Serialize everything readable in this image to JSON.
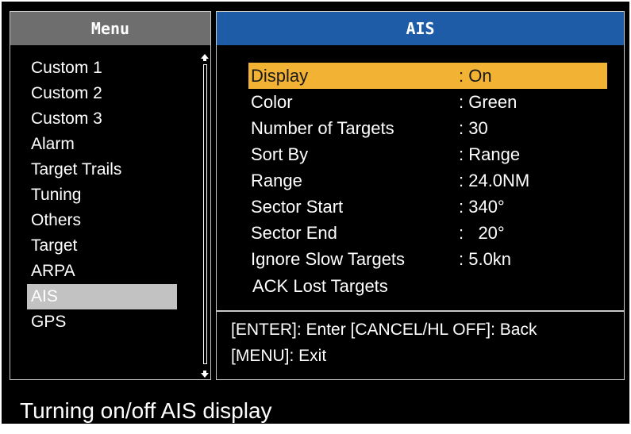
{
  "menu": {
    "title": "Menu",
    "items": [
      {
        "label": "Custom 1"
      },
      {
        "label": "Custom 2"
      },
      {
        "label": "Custom 3"
      },
      {
        "label": "Alarm"
      },
      {
        "label": "Target Trails"
      },
      {
        "label": "Tuning"
      },
      {
        "label": "Others"
      },
      {
        "label": "Target"
      },
      {
        "label": "ARPA"
      },
      {
        "label": "AIS"
      },
      {
        "label": "GPS"
      }
    ],
    "selected_index": 9
  },
  "ais": {
    "title": "AIS",
    "settings": [
      {
        "label": "Display",
        "value": ": On"
      },
      {
        "label": "Color",
        "value": ": Green"
      },
      {
        "label": "Number of Targets",
        "value": ": 30"
      },
      {
        "label": "Sort By",
        "value": ": Range"
      },
      {
        "label": "Range",
        "value": ": 24.0NM"
      },
      {
        "label": "Sector Start",
        "value": ": 340°"
      },
      {
        "label": "Sector End",
        "value": ":   20°"
      },
      {
        "label": "Ignore Slow Targets",
        "value": ": 5.0kn"
      }
    ],
    "selected_index": 0,
    "ack_label": "ACK Lost Targets",
    "help_line1": "[ENTER]: Enter [CANCEL/HL OFF]: Back",
    "help_line2": "[MENU]: Exit"
  },
  "caption": "Turning on/off AIS display",
  "colors": {
    "background": "#000000",
    "menu_header": "#6e6e6e",
    "ais_header": "#1f5ca8",
    "highlight": "#f2b233",
    "menu_selected": "#c2c2c2",
    "text": "#ffffff"
  }
}
